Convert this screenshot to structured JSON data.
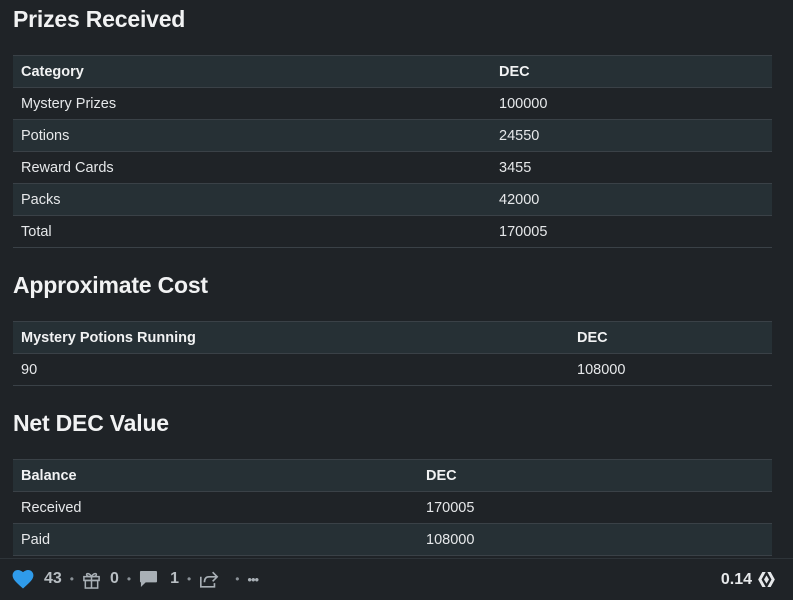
{
  "sections": [
    {
      "title": "Prizes Received",
      "headers": [
        "Category",
        "DEC"
      ],
      "rows": [
        [
          "Mystery Prizes",
          "100000"
        ],
        [
          "Potions",
          "24550"
        ],
        [
          "Reward Cards",
          "3455"
        ],
        [
          "Packs",
          "42000"
        ],
        [
          "Total",
          "170005"
        ]
      ]
    },
    {
      "title": "Approximate Cost",
      "headers": [
        "Mystery Potions Running",
        "DEC"
      ],
      "rows": [
        [
          "90",
          "108000"
        ]
      ]
    },
    {
      "title": "Net DEC Value",
      "headers": [
        "Balance",
        "DEC"
      ],
      "rows": [
        [
          "Received",
          "170005"
        ],
        [
          "Paid",
          "108000"
        ]
      ]
    }
  ],
  "footer": {
    "votes": "43",
    "gifts": "0",
    "comments": "1",
    "more": "•••",
    "payout": "0.14",
    "icons": [
      "heart-icon",
      "gift-icon",
      "comment-icon",
      "share-icon",
      "more-icon",
      "hive-icon"
    ],
    "heart_color": "#2f9bea"
  }
}
